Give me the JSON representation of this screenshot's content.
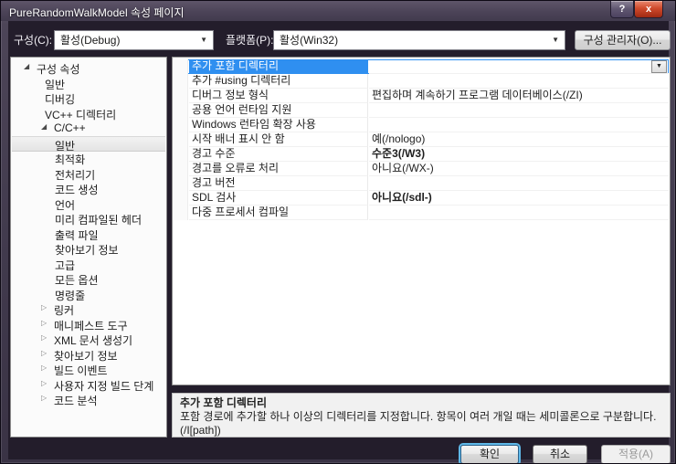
{
  "window": {
    "title": "PureRandomWalkModel 속성 페이지",
    "help_glyph": "?",
    "close_glyph": "x"
  },
  "toolbar": {
    "config_label": "구성(C):",
    "config_value": "활성(Debug)",
    "platform_label": "플랫폼(P):",
    "platform_value": "활성(Win32)",
    "config_manager_label": "구성 관리자(O)..."
  },
  "glyphs": {
    "expanded": "◢",
    "collapsed": "▷",
    "dropdown": "▼"
  },
  "tree": {
    "items": [
      {
        "label": "구성 속성",
        "level": 0,
        "state": "expanded",
        "selected": false
      },
      {
        "label": "일반",
        "level": 1,
        "state": "leaf",
        "selected": false
      },
      {
        "label": "디버깅",
        "level": 1,
        "state": "leaf",
        "selected": false
      },
      {
        "label": "VC++ 디렉터리",
        "level": 1,
        "state": "leaf",
        "selected": false
      },
      {
        "label": "C/C++",
        "level": 1,
        "state": "expanded",
        "selected": false
      },
      {
        "label": "일반",
        "level": 2,
        "state": "leaf",
        "selected": true
      },
      {
        "label": "최적화",
        "level": 2,
        "state": "leaf",
        "selected": false
      },
      {
        "label": "전처리기",
        "level": 2,
        "state": "leaf",
        "selected": false
      },
      {
        "label": "코드 생성",
        "level": 2,
        "state": "leaf",
        "selected": false
      },
      {
        "label": "언어",
        "level": 2,
        "state": "leaf",
        "selected": false
      },
      {
        "label": "미리 컴파일된 헤더",
        "level": 2,
        "state": "leaf",
        "selected": false
      },
      {
        "label": "출력 파일",
        "level": 2,
        "state": "leaf",
        "selected": false
      },
      {
        "label": "찾아보기 정보",
        "level": 2,
        "state": "leaf",
        "selected": false
      },
      {
        "label": "고급",
        "level": 2,
        "state": "leaf",
        "selected": false
      },
      {
        "label": "모든 옵션",
        "level": 2,
        "state": "leaf",
        "selected": false
      },
      {
        "label": "명령줄",
        "level": 2,
        "state": "leaf",
        "selected": false
      },
      {
        "label": "링커",
        "level": 1,
        "state": "collapsed",
        "selected": false
      },
      {
        "label": "매니페스트 도구",
        "level": 1,
        "state": "collapsed",
        "selected": false
      },
      {
        "label": "XML 문서 생성기",
        "level": 1,
        "state": "collapsed",
        "selected": false
      },
      {
        "label": "찾아보기 정보",
        "level": 1,
        "state": "collapsed",
        "selected": false
      },
      {
        "label": "빌드 이벤트",
        "level": 1,
        "state": "collapsed",
        "selected": false
      },
      {
        "label": "사용자 지정 빌드 단계",
        "level": 1,
        "state": "collapsed",
        "selected": false
      },
      {
        "label": "코드 분석",
        "level": 1,
        "state": "collapsed",
        "selected": false
      }
    ]
  },
  "grid": {
    "rows": [
      {
        "name": "추가 포함 디렉터리",
        "value": "",
        "selected": true,
        "bold": false,
        "has_dropdown": true
      },
      {
        "name": "추가 #using 디렉터리",
        "value": "",
        "selected": false,
        "bold": false,
        "has_dropdown": false
      },
      {
        "name": "디버그 정보 형식",
        "value": "편집하며 계속하기 프로그램 데이터베이스(/ZI)",
        "selected": false,
        "bold": false,
        "has_dropdown": false
      },
      {
        "name": "공용 언어 런타임 지원",
        "value": "",
        "selected": false,
        "bold": false,
        "has_dropdown": false
      },
      {
        "name": "Windows 런타임 확장 사용",
        "value": "",
        "selected": false,
        "bold": false,
        "has_dropdown": false
      },
      {
        "name": "시작 배너 표시 안 함",
        "value": "예(/nologo)",
        "selected": false,
        "bold": false,
        "has_dropdown": false
      },
      {
        "name": "경고 수준",
        "value": "수준3(/W3)",
        "selected": false,
        "bold": true,
        "has_dropdown": false
      },
      {
        "name": "경고를 오류로 처리",
        "value": "아니요(/WX-)",
        "selected": false,
        "bold": false,
        "has_dropdown": false
      },
      {
        "name": "경고 버전",
        "value": "",
        "selected": false,
        "bold": false,
        "has_dropdown": false
      },
      {
        "name": "SDL 검사",
        "value": "아니요(/sdl-)",
        "selected": false,
        "bold": true,
        "has_dropdown": false
      },
      {
        "name": "다중 프로세서 컴파일",
        "value": "",
        "selected": false,
        "bold": false,
        "has_dropdown": false
      }
    ]
  },
  "description": {
    "title": "추가 포함 디렉터리",
    "body": "포함 경로에 추가할 하나 이상의 디렉터리를 지정합니다. 항목이 여러 개일 때는 세미콜론으로 구분합니다.",
    "body2": "(/I[path])"
  },
  "footer": {
    "ok_label": "확인",
    "cancel_label": "취소",
    "apply_label": "적용(A)"
  },
  "colors": {
    "selection_blue": "#2f8ff0",
    "close_red": "#cf4a2c",
    "titlebar_purple": "#4a4256"
  }
}
